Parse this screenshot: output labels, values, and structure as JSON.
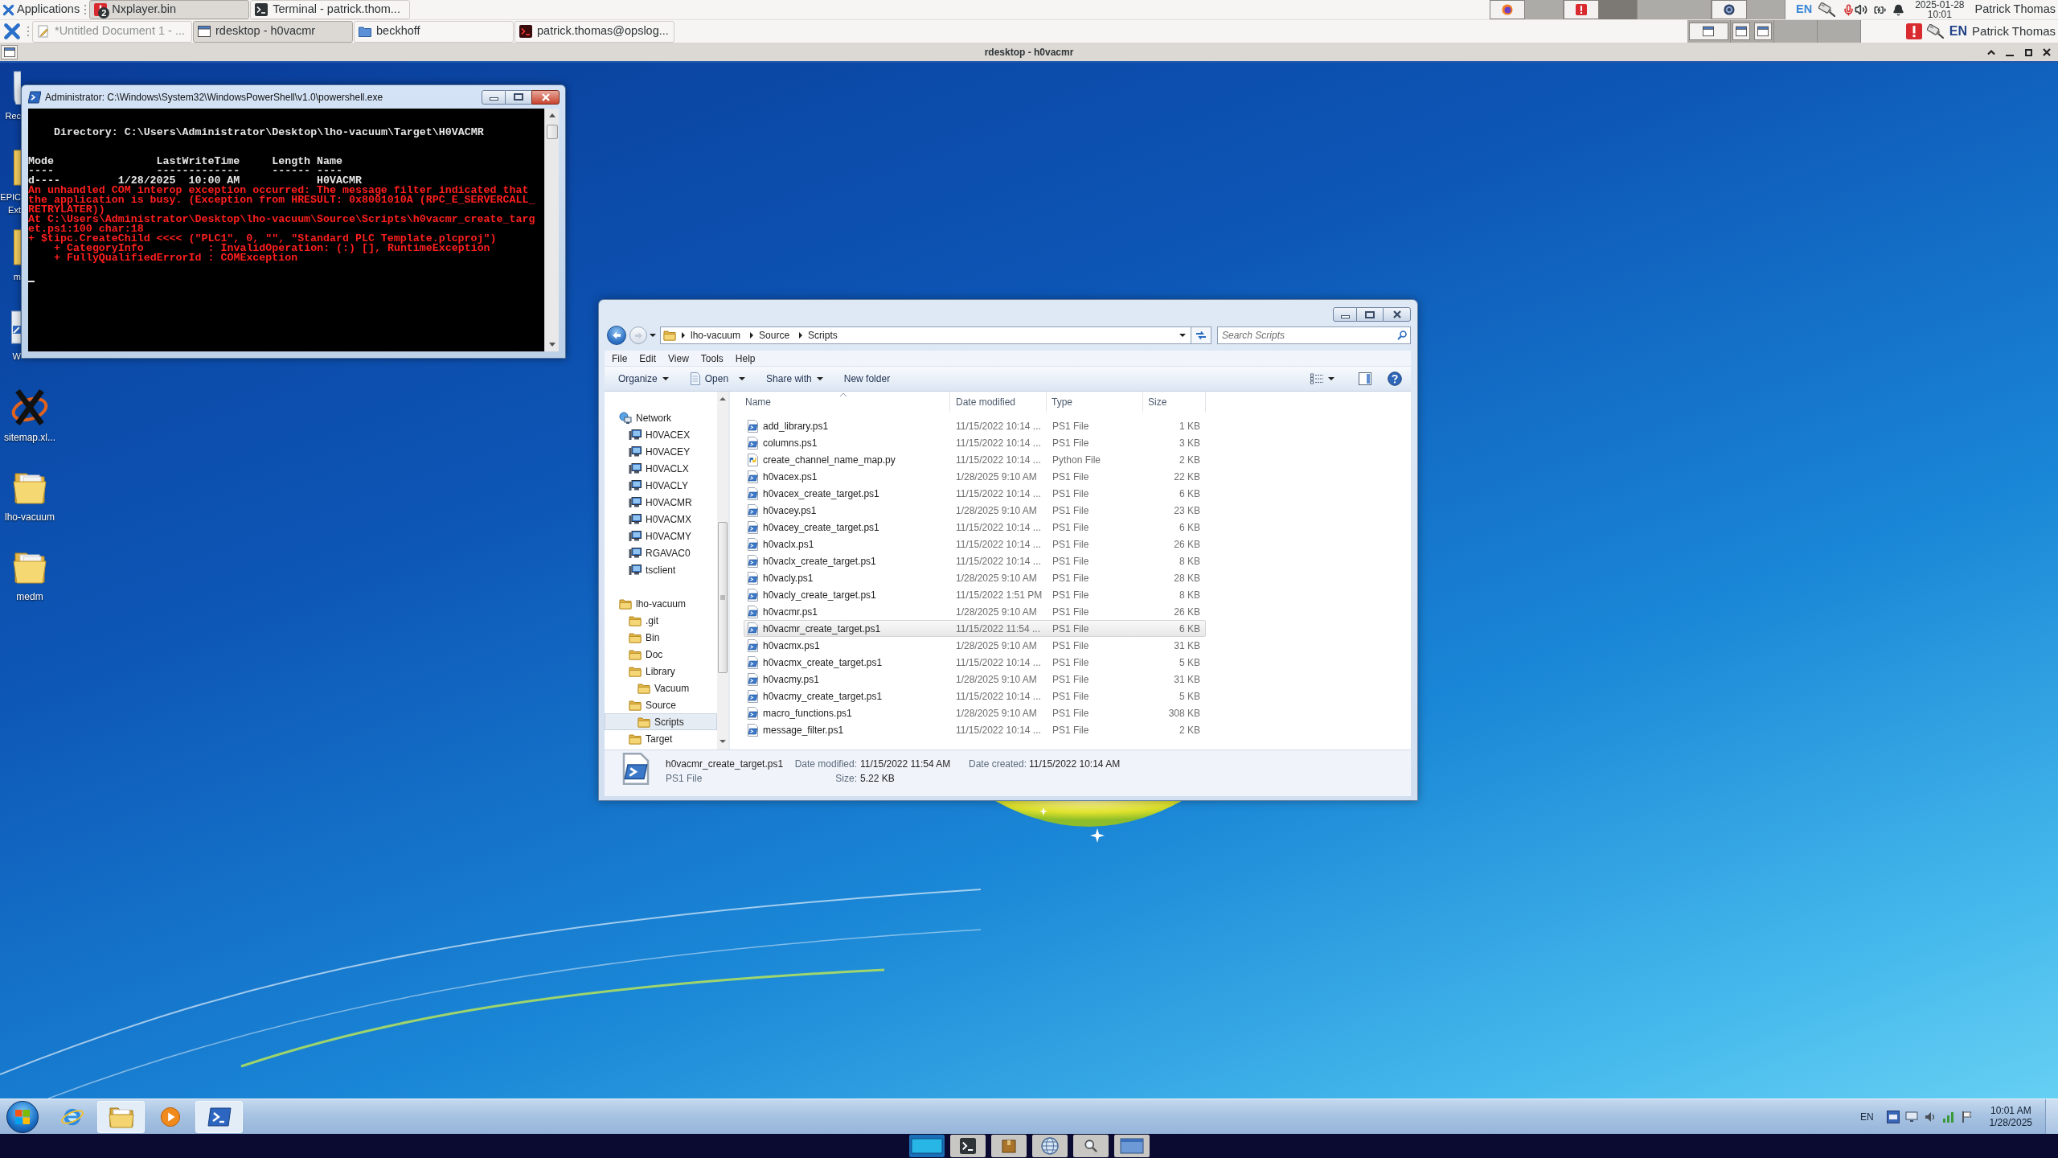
{
  "top_panel": {
    "applications_label": "Applications",
    "tasks": [
      {
        "label": "Nxplayer.bin",
        "kind": "alert",
        "badge": "2",
        "selected": true,
        "minimized": false
      },
      {
        "label": "Terminal - patrick.thom...",
        "kind": "terminal",
        "selected": false,
        "minimized": false
      }
    ],
    "workspaces": [
      {
        "selected": false,
        "windows": [
          {
            "kind": "browser"
          }
        ]
      },
      {
        "selected": true,
        "windows": [
          {
            "kind": "alert"
          }
        ]
      },
      {
        "selected": false
      },
      {
        "selected": false,
        "windows": [
          {
            "kind": "disc"
          }
        ]
      }
    ],
    "language": "EN",
    "date": "2025-01-28",
    "time": "10:01",
    "user": "Patrick Thomas"
  },
  "second_panel": {
    "tasks": [
      {
        "label": "*Untitled Document 1 - ...",
        "kind": "editor",
        "selected": false,
        "minimized": true
      },
      {
        "label": "rdesktop - h0vacmr",
        "kind": "window",
        "selected": true,
        "minimized": false
      },
      {
        "label": "beckhoff",
        "kind": "folder",
        "selected": false,
        "minimized": false
      },
      {
        "label": "patrick.thomas@opslog...",
        "kind": "ssh",
        "selected": false,
        "minimized": false
      }
    ],
    "workspaces": [
      {
        "selected": false,
        "windows": [
          {
            "kind": "window"
          }
        ]
      },
      {
        "selected": false,
        "windows": [
          {
            "kind": "window"
          },
          {
            "kind": "window"
          }
        ]
      },
      {
        "selected": false
      },
      {
        "selected": false
      }
    ],
    "language": "EN",
    "user": "Patrick Thomas"
  },
  "remote_window": {
    "title": "rdesktop - h0vacmr"
  },
  "desktop_icons": [
    {
      "label": "Rec",
      "kind": "recycle_bin",
      "covered": true
    },
    {
      "label": "EPIC Ext",
      "kind": "folder",
      "covered": true
    },
    {
      "label": "m",
      "kind": "folder",
      "covered": true
    },
    {
      "label": "W",
      "kind": "shortcut",
      "covered": true
    },
    {
      "label": "sitemap.xl...",
      "kind": "spreadsheet",
      "covered": false
    },
    {
      "label": "lho-vacuum",
      "kind": "folder",
      "covered": false
    },
    {
      "label": "medm",
      "kind": "folder",
      "covered": false
    }
  ],
  "powershell": {
    "title": "Administrator: C:\\Windows\\System32\\WindowsPowerShell\\v1.0\\powershell.exe",
    "active": true,
    "lines": [
      {
        "kind": "blank"
      },
      {
        "kind": "blank"
      },
      {
        "kind": "output",
        "indented": true,
        "text": "Directory: C:\\Users\\Administrator\\Desktop\\lho-vacuum\\Target\\H0VACMR"
      },
      {
        "kind": "blank"
      },
      {
        "kind": "blank"
      },
      {
        "kind": "output",
        "indented": false,
        "text": "Mode                LastWriteTime     Length Name"
      },
      {
        "kind": "output",
        "indented": false,
        "text": "----                -------------     ------ ----"
      },
      {
        "kind": "output",
        "indented": false,
        "text": "d----         1/28/2025  10:00 AM            H0VACMR"
      },
      {
        "kind": "error",
        "indented": false,
        "text": "An unhandled COM interop exception occurred: The message filter indicated that"
      },
      {
        "kind": "error",
        "indented": false,
        "text": "the application is busy. (Exception from HRESULT: 0x8001010A (RPC_E_SERVERCALL_"
      },
      {
        "kind": "error",
        "indented": false,
        "text": "RETRYLATER))"
      },
      {
        "kind": "error",
        "indented": false,
        "text": "At C:\\Users\\Administrator\\Desktop\\lho-vacuum\\Source\\Scripts\\h0vacmr_create_targ"
      },
      {
        "kind": "error",
        "indented": false,
        "text": "et.ps1:100 char:18"
      },
      {
        "kind": "error",
        "indented": false,
        "text": "+ $tipc.CreateChild <<<< (\"PLC1\", 0, \"\", \"Standard PLC Template.plcproj\")"
      },
      {
        "kind": "error",
        "indented": true,
        "text": "+ CategoryInfo          : InvalidOperation: (:) [], RuntimeException"
      },
      {
        "kind": "error",
        "indented": true,
        "text": "+ FullyQualifiedErrorId : COMException"
      },
      {
        "kind": "blank"
      },
      {
        "kind": "cursor"
      }
    ]
  },
  "explorer": {
    "active": false,
    "breadcrumb": [
      "lho-vacuum",
      "Source",
      "Scripts"
    ],
    "search": {
      "placeholder": "Search Scripts"
    },
    "menu": [
      "File",
      "Edit",
      "View",
      "Tools",
      "Help"
    ],
    "commands": [
      {
        "label": "Organize",
        "kind": "menu"
      },
      {
        "label": "Open",
        "kind": "split"
      },
      {
        "label": "Share with",
        "kind": "menu"
      },
      {
        "label": "New folder",
        "kind": "plain"
      }
    ],
    "nav": [
      {
        "label": "Network",
        "kind": "network",
        "selected": false,
        "children": [
          {
            "label": "H0VACEX",
            "kind": "computer",
            "selected": false
          },
          {
            "label": "H0VACEY",
            "kind": "computer",
            "selected": false
          },
          {
            "label": "H0VACLX",
            "kind": "computer",
            "selected": false
          },
          {
            "label": "H0VACLY",
            "kind": "computer",
            "selected": false
          },
          {
            "label": "H0VACMR",
            "kind": "computer",
            "selected": false
          },
          {
            "label": "H0VACMX",
            "kind": "computer",
            "selected": false
          },
          {
            "label": "H0VACMY",
            "kind": "computer",
            "selected": false
          },
          {
            "label": "RGAVAC0",
            "kind": "computer",
            "selected": false
          },
          {
            "label": "tsclient",
            "kind": "computer",
            "selected": false
          }
        ]
      },
      {
        "label": "lho-vacuum",
        "kind": "folder",
        "selected": false,
        "children": [
          {
            "label": ".git",
            "kind": "folder",
            "selected": false
          },
          {
            "label": "Bin",
            "kind": "folder",
            "selected": false
          },
          {
            "label": "Doc",
            "kind": "folder",
            "selected": false
          },
          {
            "label": "Library",
            "kind": "folder",
            "selected": false,
            "children": [
              {
                "label": "Vacuum",
                "kind": "folder",
                "selected": false
              }
            ]
          },
          {
            "label": "Source",
            "kind": "folder",
            "selected": false,
            "children": [
              {
                "label": "Scripts",
                "kind": "folder",
                "selected": true
              }
            ]
          },
          {
            "label": "Target",
            "kind": "folder",
            "selected": false
          }
        ]
      }
    ],
    "columns": [
      {
        "label": "Name",
        "sorted": true
      },
      {
        "label": "Date modified",
        "sorted": false
      },
      {
        "label": "Type",
        "sorted": false
      },
      {
        "label": "Size",
        "sorted": false
      }
    ],
    "files": [
      {
        "name": "add_library.ps1",
        "modified": "11/15/2022 10:14 ...",
        "type": "PS1 File",
        "size": "1 KB",
        "kind": "ps1",
        "selected": false
      },
      {
        "name": "columns.ps1",
        "modified": "11/15/2022 10:14 ...",
        "type": "PS1 File",
        "size": "3 KB",
        "kind": "ps1",
        "selected": false
      },
      {
        "name": "create_channel_name_map.py",
        "modified": "11/15/2022 10:14 ...",
        "type": "Python File",
        "size": "2 KB",
        "kind": "py",
        "selected": false
      },
      {
        "name": "h0vacex.ps1",
        "modified": "1/28/2025 9:10 AM",
        "type": "PS1 File",
        "size": "22 KB",
        "kind": "ps1",
        "selected": false
      },
      {
        "name": "h0vacex_create_target.ps1",
        "modified": "11/15/2022 10:14 ...",
        "type": "PS1 File",
        "size": "6 KB",
        "kind": "ps1",
        "selected": false
      },
      {
        "name": "h0vacey.ps1",
        "modified": "1/28/2025 9:10 AM",
        "type": "PS1 File",
        "size": "23 KB",
        "kind": "ps1",
        "selected": false
      },
      {
        "name": "h0vacey_create_target.ps1",
        "modified": "11/15/2022 10:14 ...",
        "type": "PS1 File",
        "size": "6 KB",
        "kind": "ps1",
        "selected": false
      },
      {
        "name": "h0vaclx.ps1",
        "modified": "11/15/2022 10:14 ...",
        "type": "PS1 File",
        "size": "26 KB",
        "kind": "ps1",
        "selected": false
      },
      {
        "name": "h0vaclx_create_target.ps1",
        "modified": "11/15/2022 10:14 ...",
        "type": "PS1 File",
        "size": "8 KB",
        "kind": "ps1",
        "selected": false
      },
      {
        "name": "h0vacly.ps1",
        "modified": "1/28/2025 9:10 AM",
        "type": "PS1 File",
        "size": "28 KB",
        "kind": "ps1",
        "selected": false
      },
      {
        "name": "h0vacly_create_target.ps1",
        "modified": "11/15/2022 1:51 PM",
        "type": "PS1 File",
        "size": "8 KB",
        "kind": "ps1",
        "selected": false
      },
      {
        "name": "h0vacmr.ps1",
        "modified": "1/28/2025 9:10 AM",
        "type": "PS1 File",
        "size": "26 KB",
        "kind": "ps1",
        "selected": false
      },
      {
        "name": "h0vacmr_create_target.ps1",
        "modified": "11/15/2022 11:54 ...",
        "type": "PS1 File",
        "size": "6 KB",
        "kind": "ps1",
        "selected": true
      },
      {
        "name": "h0vacmx.ps1",
        "modified": "1/28/2025 9:10 AM",
        "type": "PS1 File",
        "size": "31 KB",
        "kind": "ps1",
        "selected": false
      },
      {
        "name": "h0vacmx_create_target.ps1",
        "modified": "11/15/2022 10:14 ...",
        "type": "PS1 File",
        "size": "5 KB",
        "kind": "ps1",
        "selected": false
      },
      {
        "name": "h0vacmy.ps1",
        "modified": "1/28/2025 9:10 AM",
        "type": "PS1 File",
        "size": "31 KB",
        "kind": "ps1",
        "selected": false
      },
      {
        "name": "h0vacmy_create_target.ps1",
        "modified": "11/15/2022 10:14 ...",
        "type": "PS1 File",
        "size": "5 KB",
        "kind": "ps1",
        "selected": false
      },
      {
        "name": "macro_functions.ps1",
        "modified": "1/28/2025 9:10 AM",
        "type": "PS1 File",
        "size": "308 KB",
        "kind": "ps1",
        "selected": false
      },
      {
        "name": "message_filter.ps1",
        "modified": "11/15/2022 10:14 ...",
        "type": "PS1 File",
        "size": "2 KB",
        "kind": "ps1",
        "selected": false
      }
    ],
    "details": {
      "name": "h0vacmr_create_target.ps1",
      "type": "PS1 File",
      "modified_label": "Date modified:",
      "modified": "11/15/2022 11:54 AM",
      "size_label": "Size:",
      "size": "5.22 KB",
      "created_label": "Date created:",
      "created": "11/15/2022 10:14 AM"
    }
  },
  "taskbar": {
    "apps": [
      {
        "kind": "browser",
        "running": false
      },
      {
        "kind": "folder",
        "running": true
      },
      {
        "kind": "media",
        "running": false
      },
      {
        "kind": "terminal",
        "running": true
      }
    ],
    "language": "EN",
    "time": "10:01 AM",
    "date": "1/28/2025"
  }
}
